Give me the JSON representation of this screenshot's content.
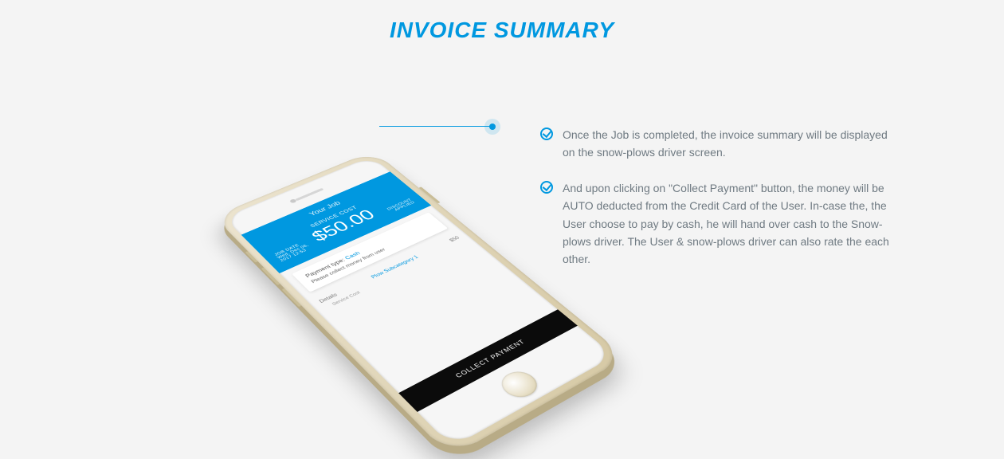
{
  "title": "INVOICE SUMMARY",
  "features": [
    "Once the Job is completed, the invoice summary will be displayed on the snow-plows driver screen.",
    "And upon clicking on \"Collect Payment\" button, the money will be AUTO deducted from the Credit Card of the User. In-case the, the User choose to pay by cash, he will hand over cash to the Snow-plows driver. The User & snow-plows driver can also rate the each other."
  ],
  "phone": {
    "header_title": "Your Job",
    "cost_label": "SERVICE COST",
    "cost": "$50.00",
    "jobdate_label": "JOB DATE",
    "jobdate": "Wed, Dec 06, 2017 12:53",
    "discount_label": "DISCOUNT APPLIED",
    "payment_type_label": "Payment type:",
    "payment_type_value": "Cash",
    "payment_note": "Please collect money from user",
    "details_label": "Details",
    "subcategory": "Plow Subcategory 1",
    "line_price": "$50",
    "service_cost_label": "Service Cost",
    "collect_btn": "COLLECT PAYMENT"
  }
}
